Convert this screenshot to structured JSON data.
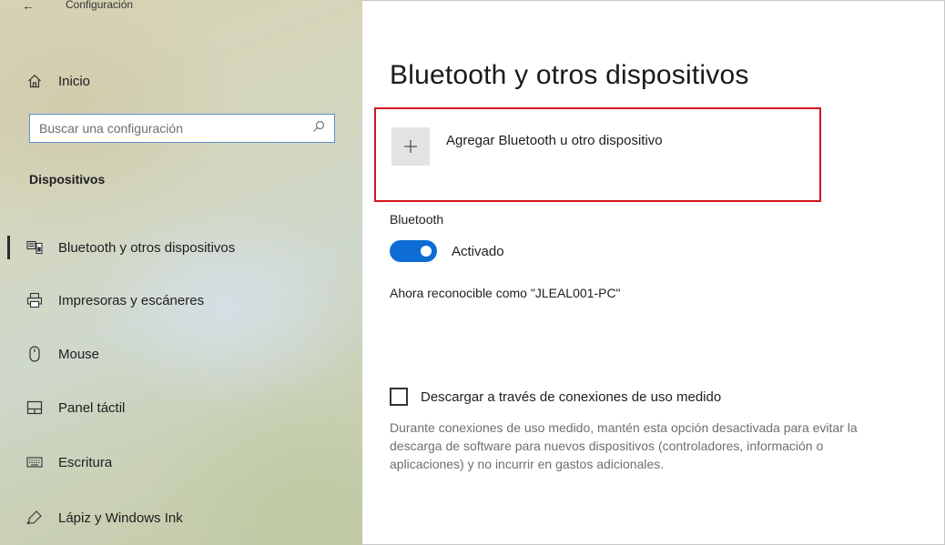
{
  "app": {
    "back_arrow": "←",
    "title": "Configuración"
  },
  "sidebar": {
    "home_label": "Inicio",
    "search": {
      "placeholder": "Buscar una configuración",
      "value": ""
    },
    "section_heading": "Dispositivos",
    "items": [
      {
        "label": "Bluetooth y otros dispositivos",
        "icon": "bluetooth-devices-icon",
        "active": true
      },
      {
        "label": "Impresoras y escáneres",
        "icon": "printer-icon",
        "active": false
      },
      {
        "label": "Mouse",
        "icon": "mouse-icon",
        "active": false
      },
      {
        "label": "Panel táctil",
        "icon": "touchpad-icon",
        "active": false
      },
      {
        "label": "Escritura",
        "icon": "keyboard-icon",
        "active": false
      },
      {
        "label": "Lápiz y Windows Ink",
        "icon": "pen-icon",
        "active": false
      }
    ]
  },
  "main": {
    "title": "Bluetooth y otros dispositivos",
    "add_device": {
      "plus": "+",
      "label": "Agregar Bluetooth u otro dispositivo"
    },
    "bluetooth": {
      "label": "Bluetooth",
      "toggle_state": "Activado",
      "on": true
    },
    "discoverable_text": "Ahora reconocible como \"JLEAL001-PC\"",
    "metered": {
      "checkbox_label": "Descargar a través de conexiones de uso medido",
      "checked": false,
      "description": "Durante conexiones de uso medido, mantén esta opción desactivada para evitar la descarga de software para nuevos dispositivos (controladores, información o aplicaciones) y no incurrir en gastos adicionales."
    }
  },
  "colors": {
    "accent": "#0f6cd4",
    "highlight_border": "#d4161c",
    "search_border": "#5b8fcf"
  }
}
